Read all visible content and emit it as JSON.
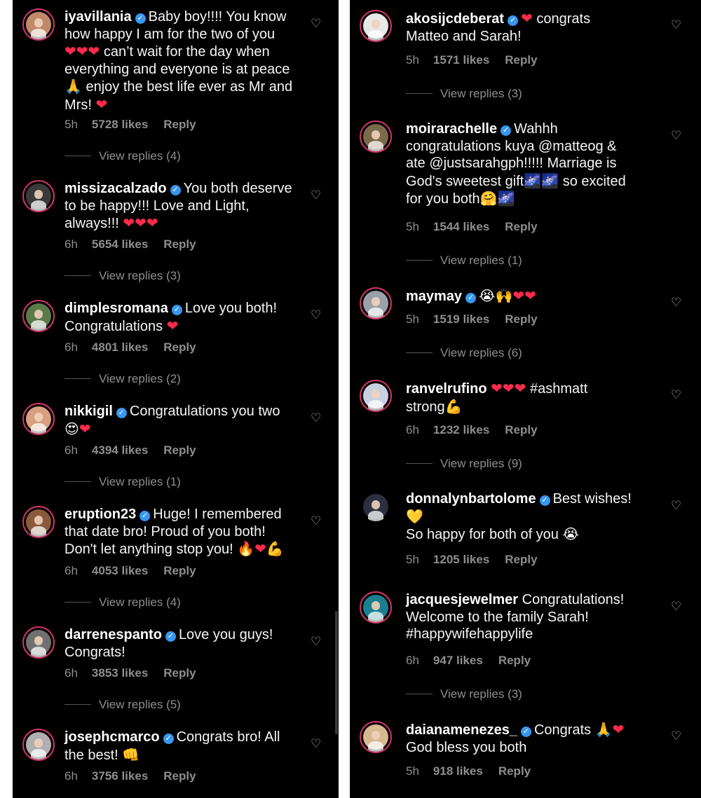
{
  "colors": {
    "background": "#000000",
    "text": "#f5f5f5",
    "muted": "#8e8e8e",
    "verified": "#3897f0",
    "story_ring": "#d1356a",
    "heart": "#ff2b4a"
  },
  "icons": {
    "verified": "verified-badge-icon",
    "like": "heart-outline-icon"
  },
  "left": {
    "comments": [
      {
        "username": "iyavillania",
        "verified": true,
        "lines": [
          "Baby boy!!!! You know",
          "how happy I am for the two of you",
          "❤❤❤ can’t wait for the day when",
          "everything and everyone is at peace",
          "🙏 enjoy the best life ever as Mr and",
          "Mrs! ❤"
        ],
        "time": "5h",
        "likes": "5728 likes",
        "reply": "Reply",
        "view_replies": "View replies (4)"
      },
      {
        "username": "missizacalzado",
        "verified": true,
        "lines": [
          "You both deserve",
          "to be happy!!! Love and Light,",
          "always!!! ❤❤❤"
        ],
        "time": "6h",
        "likes": "5654 likes",
        "reply": "Reply",
        "view_replies": "View replies (3)"
      },
      {
        "username": "dimplesromana",
        "verified": true,
        "lines": [
          "Love you both!",
          "Congratulations ❤"
        ],
        "time": "6h",
        "likes": "4801 likes",
        "reply": "Reply",
        "view_replies": "View replies (2)"
      },
      {
        "username": "nikkigil",
        "verified": true,
        "lines": [
          "Congratulations you two",
          "😍❤"
        ],
        "time": "6h",
        "likes": "4394 likes",
        "reply": "Reply",
        "view_replies": "View replies (1)"
      },
      {
        "username": "eruption23",
        "verified": true,
        "lines": [
          "Huge! I remembered",
          "that date bro! Proud of you both!",
          "Don't let anything stop you! 🔥❤💪"
        ],
        "time": "6h",
        "likes": "4053 likes",
        "reply": "Reply",
        "view_replies": "View replies (4)"
      },
      {
        "username": "darrenespanto",
        "verified": true,
        "lines": [
          "Love you guys!",
          "Congrats!"
        ],
        "time": "6h",
        "likes": "3853 likes",
        "reply": "Reply",
        "view_replies": "View replies (5)"
      },
      {
        "username": "josephcmarco",
        "verified": true,
        "lines": [
          "Congrats bro! All",
          "the best! 👊"
        ],
        "time": "6h",
        "likes": "3756 likes",
        "reply": "Reply",
        "view_replies": ""
      }
    ]
  },
  "right": {
    "comments": [
      {
        "username": "akosijcdeberat",
        "verified": true,
        "lines": [
          "❤ congrats",
          "Matteo and Sarah!"
        ],
        "time": "5h",
        "likes": "1571 likes",
        "reply": "Reply",
        "view_replies": "View replies (3)"
      },
      {
        "username": "moirarachelle",
        "verified": true,
        "lines": [
          "Wahhh",
          "congratulations kuya @matteog &",
          "ate @justsarahgph!!!!! Marriage is",
          "God's sweetest gift🌌🌌 so excited",
          "for you both🤗🌌"
        ],
        "time": "5h",
        "likes": "1544 likes",
        "reply": "Reply",
        "view_replies": "View replies (1)"
      },
      {
        "username": "maymay",
        "verified": true,
        "lines": [
          "😭🙌❤❤"
        ],
        "time": "5h",
        "likes": "1519 likes",
        "reply": "Reply",
        "view_replies": "View replies (6)"
      },
      {
        "username": "ranvelrufino",
        "verified": false,
        "lines": [
          "❤❤❤ #ashmatt",
          "strong💪"
        ],
        "time": "6h",
        "likes": "1232 likes",
        "reply": "Reply",
        "view_replies": "View replies (9)"
      },
      {
        "username": "donnalynbartolome",
        "verified": true,
        "lines": [
          "Best wishes!",
          "💛",
          "So happy for both of you 😭"
        ],
        "time": "5h",
        "likes": "1205 likes",
        "reply": "Reply",
        "view_replies": ""
      },
      {
        "username": "jacquesjewelmer",
        "verified": false,
        "lines": [
          "Congratulations!",
          "Welcome to the family Sarah!",
          "#happywifehappylife"
        ],
        "time": "6h",
        "likes": "947 likes",
        "reply": "Reply",
        "view_replies": "View replies (3)"
      },
      {
        "username": "daianamenezes_",
        "verified": true,
        "lines": [
          "Congrats 🙏❤",
          "God bless you both"
        ],
        "time": "5h",
        "likes": "918 likes",
        "reply": "Reply",
        "view_replies": ""
      }
    ]
  }
}
